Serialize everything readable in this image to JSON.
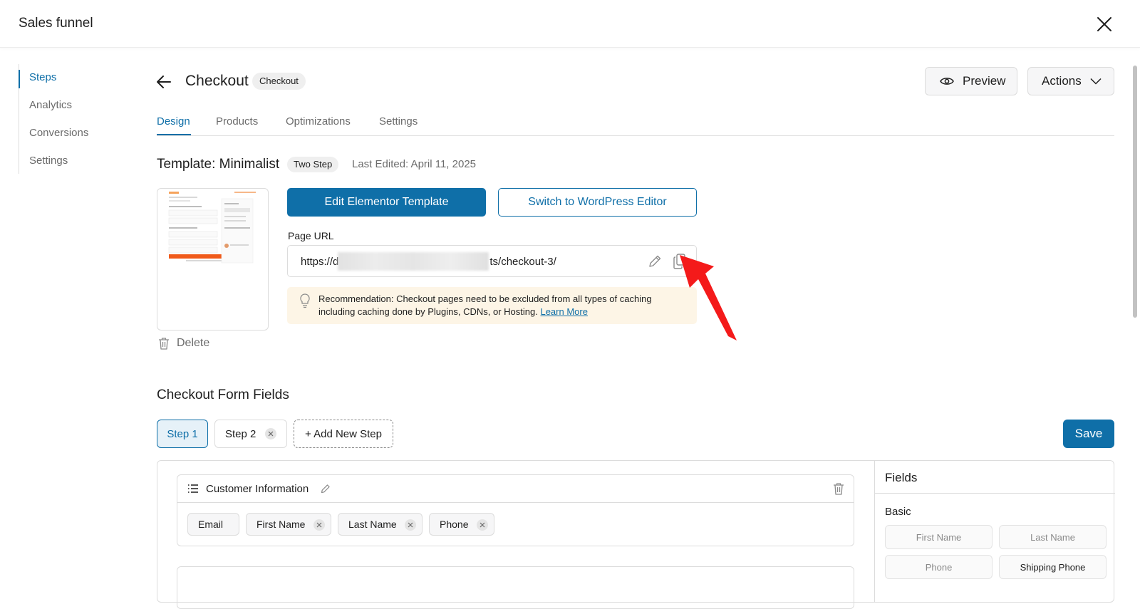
{
  "app": {
    "title": "Sales funnel"
  },
  "sidebar": {
    "items": [
      {
        "label": "Steps"
      },
      {
        "label": "Analytics"
      },
      {
        "label": "Conversions"
      },
      {
        "label": "Settings"
      }
    ]
  },
  "step": {
    "title": "Checkout",
    "type_badge": "Checkout",
    "preview_label": "Preview",
    "actions_label": "Actions"
  },
  "tabs": [
    {
      "label": "Design"
    },
    {
      "label": "Products"
    },
    {
      "label": "Optimizations"
    },
    {
      "label": "Settings"
    }
  ],
  "template": {
    "title": "Template: Minimalist",
    "steps_badge": "Two Step",
    "last_edited": "Last Edited: April 11, 2025",
    "delete_label": "Delete",
    "edit_button": "Edit Elementor Template",
    "switch_button": "Switch to WordPress Editor",
    "url_label": "Page URL",
    "url_prefix": "https://d",
    "url_suffix": "ts/checkout-3/",
    "recommendation": "Recommendation: Checkout pages need to be excluded from all types of caching including caching done by Plugins, CDNs, or Hosting.",
    "learn_more": "Learn More"
  },
  "form": {
    "title": "Checkout Form Fields",
    "steps": [
      {
        "label": "Step 1"
      },
      {
        "label": "Step 2"
      }
    ],
    "add_step": "+ Add New Step",
    "save": "Save",
    "section": {
      "title": "Customer Information",
      "fields": [
        {
          "label": "Email"
        },
        {
          "label": "First Name"
        },
        {
          "label": "Last Name"
        },
        {
          "label": "Phone"
        }
      ]
    },
    "fields_panel": {
      "title": "Fields",
      "group": "Basic",
      "items": [
        {
          "label": "First Name"
        },
        {
          "label": "Last Name"
        },
        {
          "label": "Phone"
        },
        {
          "label": "Shipping Phone"
        }
      ]
    }
  },
  "colors": {
    "accent": "#0f6fa8",
    "annotation_arrow": "#f41a1a",
    "recommendation_bg": "#fdf5e6"
  }
}
